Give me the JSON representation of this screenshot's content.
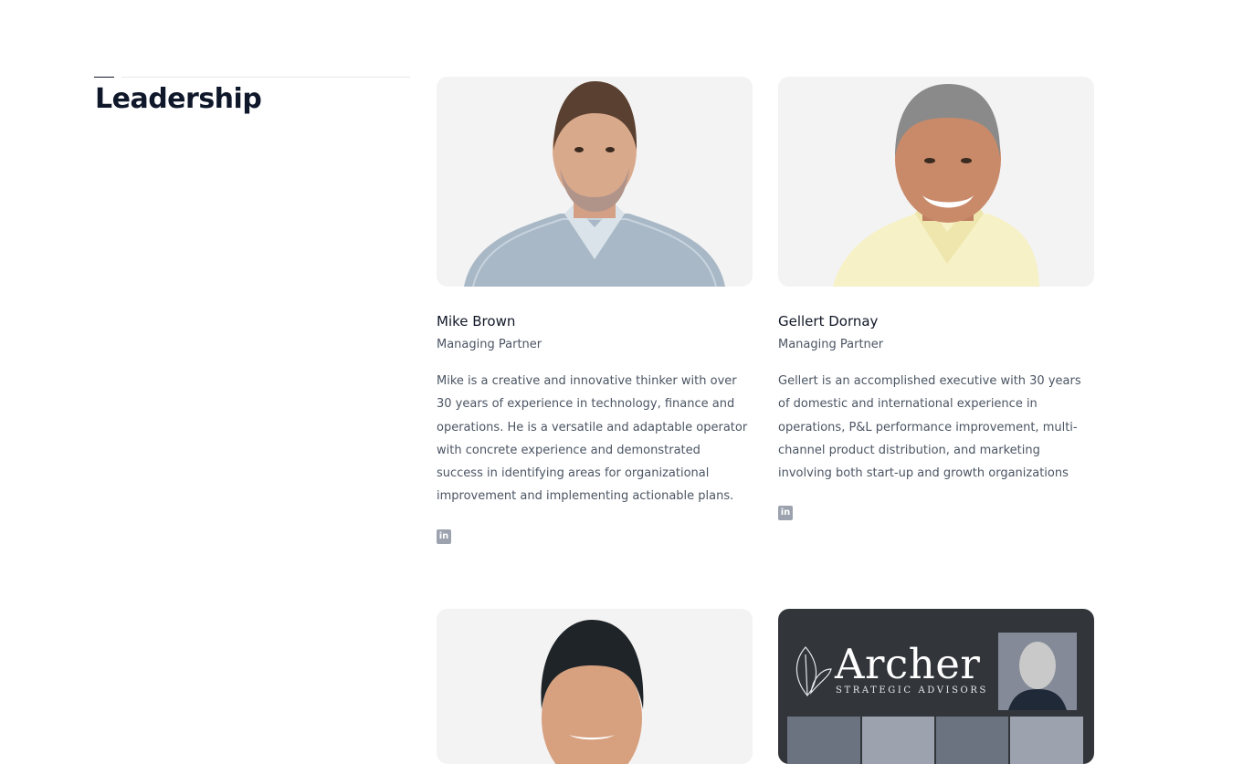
{
  "section": {
    "title": "Leadership"
  },
  "leaders": [
    {
      "name": "Mike Brown",
      "role": "Managing Partner",
      "bio": "Mike is a creative and innovative thinker with over 30 years of experience in technology, finance and operations. He is a versatile and adaptable operator with concrete experience and demonstrated success in identifying areas for organizational improvement and implementing actionable plans.",
      "social_icon": "linkedin-icon",
      "photo_colors": {
        "background": "#f3f3f3",
        "shirt": "#a9b8c6",
        "skin": "#d9a98c",
        "hair": "#5a4030"
      }
    },
    {
      "name": "Gellert Dornay",
      "role": "Managing Partner",
      "bio": "Gellert is an accomplished executive with 30 years of domestic and international experience in operations, P&L performance improvement, multi-channel product distribution, and marketing involving both start-up and growth organizations",
      "social_icon": "linkedin-icon",
      "photo_colors": {
        "background": "#f3f3f3",
        "shirt": "#f6f1c6",
        "skin": "#c98a6a",
        "hair": "#8a8a8a"
      }
    }
  ],
  "lower_cards": {
    "third_photo_colors": {
      "background": "#f3f3f3",
      "skin": "#d7a07f",
      "hair": "#1f2428"
    },
    "archer": {
      "brand": "Archer",
      "tagline": "STRATEGIC ADVISORS",
      "background": "#32363b"
    }
  },
  "colors": {
    "heading": "#0f172a",
    "text": "#4b5563",
    "icon": "#9ca3af",
    "rule": "#e5e7eb"
  }
}
